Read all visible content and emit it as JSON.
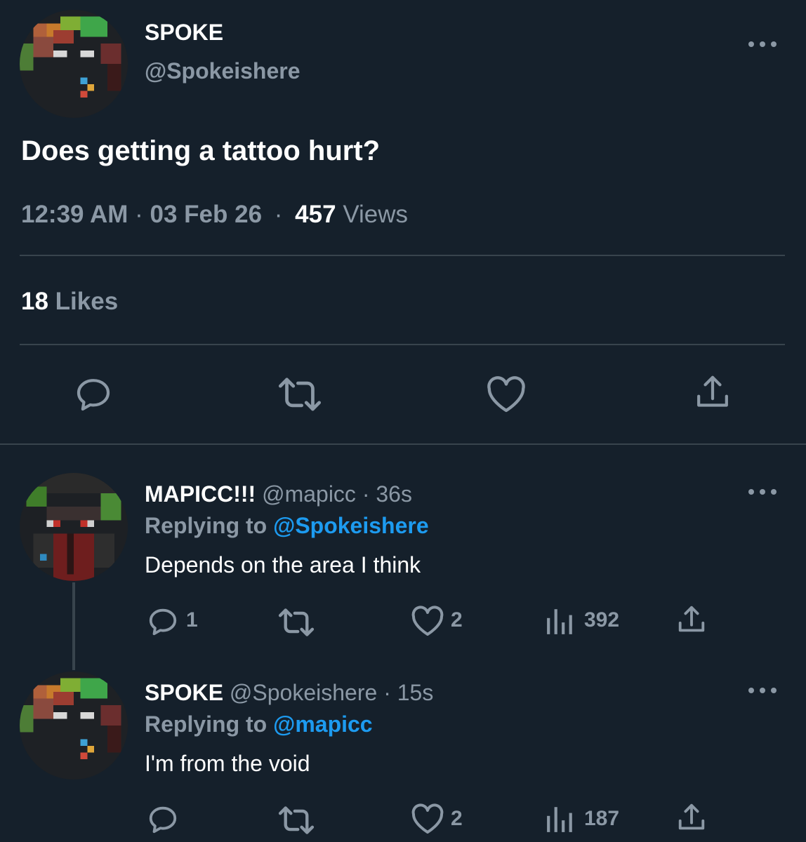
{
  "main_tweet": {
    "display_name": "SPOKE",
    "handle": "@Spokeishere",
    "text": "Does getting a tattoo hurt?",
    "time": "12:39 AM",
    "separator": "·",
    "date": "03 Feb 26",
    "views_count": "457",
    "views_label": "Views",
    "likes_count": "18",
    "likes_label": "Likes",
    "actions": [
      "reply-icon",
      "retweet-icon",
      "like-icon",
      "share-icon"
    ]
  },
  "replies": [
    {
      "display_name": "MAPICC!!!",
      "handle": "@mapicc",
      "meta_separator": "·",
      "age": "36s",
      "replying_label": "Replying to",
      "replying_to": "@Spokeishere",
      "text": "Depends on the area I think",
      "reply_count": "1",
      "retweet_count": "",
      "like_count": "2",
      "view_count": "392"
    },
    {
      "display_name": "SPOKE",
      "handle": "@Spokeishere",
      "meta_separator": "·",
      "age": "15s",
      "replying_label": "Replying to",
      "replying_to": "@mapicc",
      "text": "I'm from the void",
      "reply_count": "",
      "retweet_count": "",
      "like_count": "2",
      "view_count": "187"
    }
  ],
  "colors": {
    "background": "#15202b",
    "text": "#ffffff",
    "secondary": "#8b98a5",
    "accent": "#1d9bf0",
    "divider": "#38444d"
  }
}
